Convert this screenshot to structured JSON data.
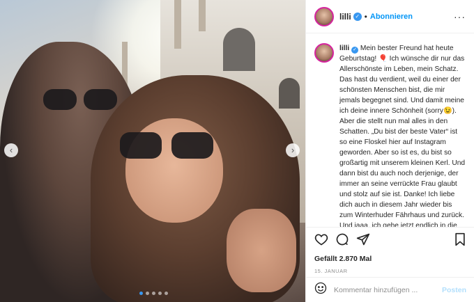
{
  "post": {
    "username": "lilli",
    "verified_icon": "verified-badge-icon",
    "separator": "•",
    "follow_label": "Abonnieren",
    "more_icon": "more-options-icon",
    "more_glyph": "···"
  },
  "caption": {
    "username": "lilli",
    "text_1": "Mein bester Freund hat heute Geburtstag!",
    "emoji_1": "🎈",
    "text_2": "Ich wünsche dir nur das Allerschönste im Leben, mein Schatz. Das hast du verdient, weil du einer der schönsten Menschen bist, die mir jemals begegnet sind. Und damit meine ich deine innere Schönheit (sorry",
    "emoji_2": "😉",
    "text_3": "). Aber die stellt nun mal alles in den Schatten. „Du bist der beste Vater“ ist so eine Floskel hier auf Instagram geworden. Aber so ist es, du bist so großartig mit unserem kleinen Kerl. Und dann bist du auch noch derjenige, der immer an seine verrückte Frau glaubt und stolz auf sie ist. Danke! Ich liebe dich auch in diesem Jahr wieder bis zum Winterhuder Fährhaus und zurück. Und jaaa, ich gehe jetzt endlich in die Küche und mache dir Huevos Rancheros!!! Gemeinsam"
  },
  "actions": {
    "like_icon": "heart-icon",
    "comment_icon": "comment-icon",
    "share_icon": "share-icon",
    "save_icon": "bookmark-icon",
    "likes_text": "Gefällt 2.870 Mal",
    "date_text": "15. JANUAR"
  },
  "comment_box": {
    "emoji_icon": "emoji-icon",
    "placeholder": "Kommentar hinzufügen ...",
    "post_label": "Posten"
  },
  "carousel": {
    "prev_glyph": "‹",
    "next_glyph": "›",
    "slide_count": 5,
    "active_index": 0,
    "active_color": "#3897f0"
  },
  "colors": {
    "accent": "#0095f6",
    "verified": "#3897f0",
    "post_disabled": "#b2dffc"
  }
}
